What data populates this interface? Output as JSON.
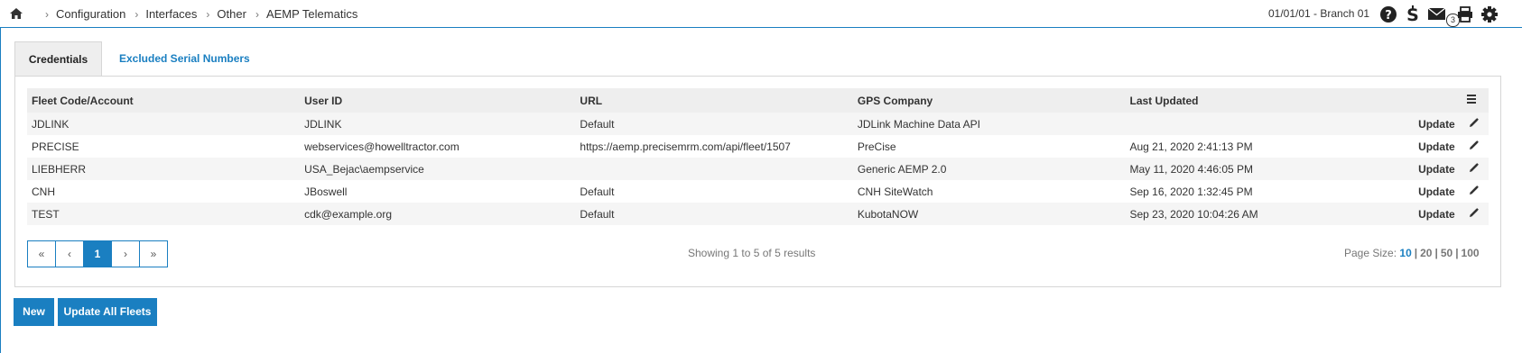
{
  "breadcrumb": [
    "Configuration",
    "Interfaces",
    "Other",
    "AEMP Telematics"
  ],
  "branch": "01/01/01 - Branch 01",
  "mail_badge": "3",
  "tabs": [
    {
      "label": "Credentials",
      "active": true
    },
    {
      "label": "Excluded Serial Numbers",
      "active": false
    }
  ],
  "table": {
    "headers": [
      "Fleet Code/Account",
      "User ID",
      "URL",
      "GPS Company",
      "Last Updated"
    ],
    "update_label": "Update",
    "rows": [
      {
        "fleet": "JDLINK",
        "user": "JDLINK",
        "url": "Default",
        "gps": "JDLink Machine Data API",
        "updated": ""
      },
      {
        "fleet": "PRECISE",
        "user": "webservices@howelltractor.com",
        "url": "https://aemp.precisemrm.com/api/fleet/1507",
        "gps": "PreCise",
        "updated": "Aug 21, 2020 2:41:13 PM"
      },
      {
        "fleet": "LIEBHERR",
        "user": "USA_Bejac\\aempservice",
        "url": "",
        "gps": "Generic AEMP 2.0",
        "updated": "May 11, 2020 4:46:05 PM"
      },
      {
        "fleet": "CNH",
        "user": "JBoswell",
        "url": "Default",
        "gps": "CNH SiteWatch",
        "updated": "Sep 16, 2020 1:32:45 PM"
      },
      {
        "fleet": "TEST",
        "user": "cdk@example.org",
        "url": "Default",
        "gps": "KubotaNOW",
        "updated": "Sep 23, 2020 10:04:26 AM"
      }
    ]
  },
  "pager": {
    "first": "«",
    "prev": "‹",
    "current": "1",
    "next": "›",
    "last": "»",
    "showing": "Showing 1 to 5 of 5 results",
    "page_size_label": "Page Size:",
    "page_sizes": [
      "10",
      "20",
      "50",
      "100"
    ],
    "page_size_selected": "10"
  },
  "buttons": {
    "new": "New",
    "update_all": "Update All Fleets"
  },
  "colors": {
    "accent": "#1a7fc1",
    "header_bg": "#eeeeee",
    "stripe": "#f5f5f5"
  }
}
